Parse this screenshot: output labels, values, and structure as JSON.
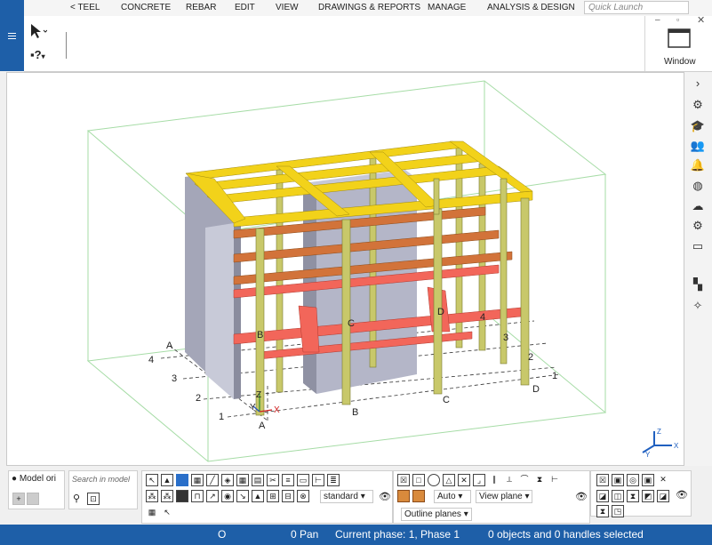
{
  "ribbon": {
    "tabs": [
      "< TEEL",
      "CONCRETE",
      "REBAR",
      "EDIT",
      "VIEW",
      "DRAWINGS & REPORTS",
      "MANAGE",
      "ANALYSIS & DESIGN"
    ],
    "quick_launch_placeholder": "Quick Launch",
    "window_label": "Window"
  },
  "left_strip": {
    "menu_icon": "hamburger-icon"
  },
  "grid_labels": {
    "letters": [
      "A",
      "B",
      "C",
      "D"
    ],
    "numbers": [
      "1",
      "2",
      "3",
      "4"
    ]
  },
  "axes": {
    "z": "Z",
    "y": "Y",
    "x": "X"
  },
  "right_toolbar": {
    "icons": [
      "chevron-right-icon",
      "help-icon",
      "graduation-cap-icon",
      "users-icon",
      "bell-icon",
      "globe-icon",
      "cloud-icon",
      "gear-icon",
      "window-icon",
      "shapes-icon",
      "sparkle-icon"
    ]
  },
  "bottom_toolbar": {
    "model_origin_label": "Model ori",
    "search_placeholder": "Search in model",
    "standard_select": "standard",
    "auto_select": "Auto",
    "view_plane_select": "View plane",
    "outline_planes_select": "Outline planes"
  },
  "status_bar": {
    "o_label": "O",
    "pan_label": "0 Pan",
    "phase": "Current phase: 1, Phase 1",
    "selection": "0 objects and 0 handles selected"
  },
  "colors": {
    "brand_blue": "#1e5fa8",
    "beam_yellow": "#f2d21a",
    "column_olive": "#c8c86a",
    "beam_orange": "#d2733a",
    "beam_red": "#f2665a",
    "wall_grey": "#a4a6b8"
  }
}
